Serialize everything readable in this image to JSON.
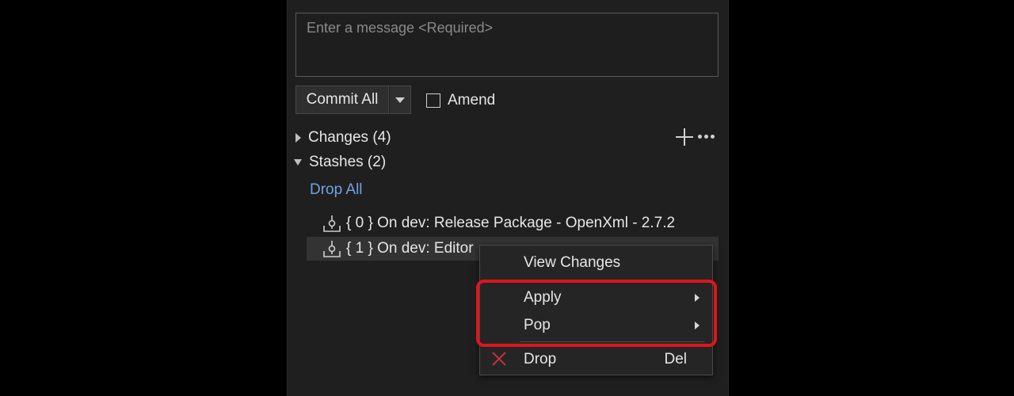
{
  "commit_panel": {
    "message_placeholder": "Enter a message <Required>",
    "commit_button_label": "Commit All",
    "amend_label": "Amend"
  },
  "changes": {
    "label": "Changes (4)"
  },
  "stashes": {
    "label": "Stashes (2)",
    "drop_all_label": "Drop All",
    "items": [
      {
        "label": "{ 0 } On dev: Release Package - OpenXml - 2.7.2"
      },
      {
        "label": "{ 1 } On dev: Editor"
      }
    ]
  },
  "context_menu": {
    "view_changes": "View Changes",
    "apply": "Apply",
    "pop": "Pop",
    "drop": "Drop",
    "drop_shortcut": "Del"
  },
  "colors": {
    "link": "#6fa3e0",
    "highlight": "#e0141c",
    "drop_icon": "#c8323a"
  }
}
